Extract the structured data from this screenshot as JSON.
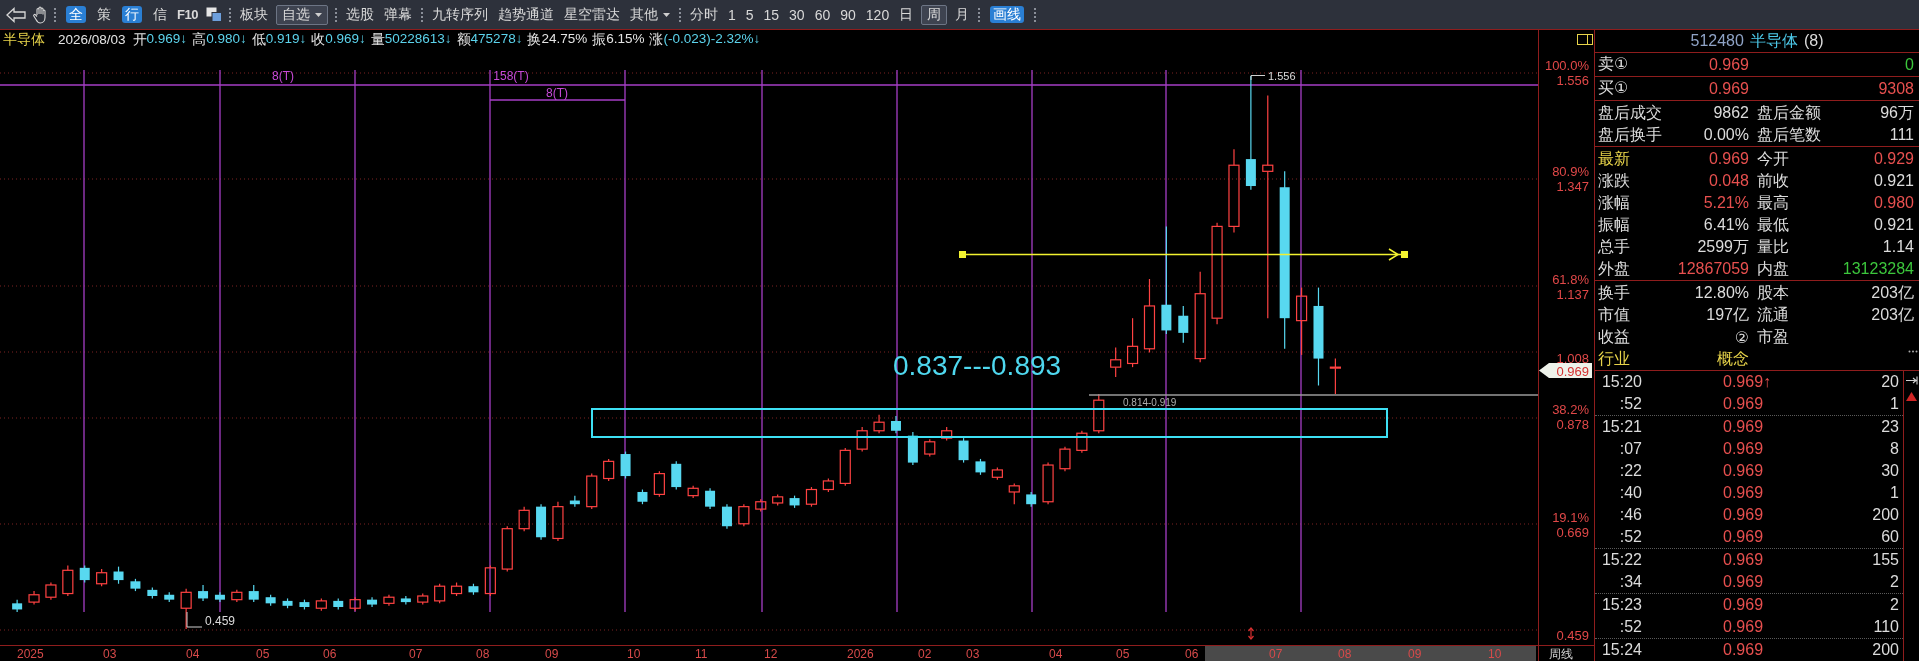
{
  "toolbar": {
    "groups": [
      {
        "items": [
          {
            "kind": "badge",
            "label": "全",
            "selected": false
          },
          {
            "kind": "text",
            "label": "策",
            "selected": false
          },
          {
            "kind": "badge",
            "label": "行",
            "selected": false
          },
          {
            "kind": "text",
            "label": "信",
            "selected": false
          },
          {
            "kind": "strong",
            "label": "F10",
            "selected": false
          }
        ]
      },
      {
        "items": [
          {
            "kind": "text",
            "label": "板块",
            "selected": false
          },
          {
            "kind": "dropdown",
            "label": "自选",
            "selected": true
          }
        ]
      },
      {
        "items": [
          {
            "kind": "text",
            "label": "选股",
            "selected": false
          },
          {
            "kind": "text",
            "label": "弹幕",
            "selected": false
          }
        ]
      },
      {
        "items": [
          {
            "kind": "text",
            "label": "九转序列",
            "selected": false
          },
          {
            "kind": "text",
            "label": "趋势通道",
            "selected": false
          },
          {
            "kind": "text",
            "label": "星空雷达",
            "selected": false
          },
          {
            "kind": "dropdown",
            "label": "其他",
            "selected": false
          }
        ]
      },
      {
        "items": [
          {
            "kind": "text",
            "label": "分时",
            "selected": false
          },
          {
            "kind": "text",
            "label": "1",
            "selected": false
          },
          {
            "kind": "text",
            "label": "5",
            "selected": false
          },
          {
            "kind": "text",
            "label": "15",
            "selected": false
          },
          {
            "kind": "text",
            "label": "30",
            "selected": false
          },
          {
            "kind": "text",
            "label": "60",
            "selected": false
          },
          {
            "kind": "text",
            "label": "90",
            "selected": false
          },
          {
            "kind": "text",
            "label": "120",
            "selected": false
          },
          {
            "kind": "text",
            "label": "日",
            "selected": false
          },
          {
            "kind": "text",
            "label": "周",
            "selected": true
          },
          {
            "kind": "text",
            "label": "月",
            "selected": false
          }
        ]
      },
      {
        "items": [
          {
            "kind": "badge",
            "label": "画线",
            "selected": false
          }
        ]
      }
    ]
  },
  "quote_bar": {
    "name": "半导体",
    "date": "2026/08/03",
    "fields": [
      {
        "label": "开",
        "value": "0.969↓",
        "color": "#5cd3ec"
      },
      {
        "label": "高",
        "value": "0.980↓",
        "color": "#5cd3ec"
      },
      {
        "label": "低",
        "value": "0.919↓",
        "color": "#5cd3ec"
      },
      {
        "label": "收",
        "value": "0.969↓",
        "color": "#5cd3ec"
      },
      {
        "label": "量",
        "value": "50228613↓",
        "color": "#5cd3ec"
      },
      {
        "label": "额",
        "value": "475278↓",
        "color": "#5cd3ec"
      },
      {
        "label": "换",
        "value": "24.75%",
        "color": "#e4e4e4"
      },
      {
        "label": "振",
        "value": "6.15%",
        "color": "#e4e4e4"
      },
      {
        "label": "涨",
        "value": "(-0.023)-2.32%↓",
        "color": "#5cd3ec"
      }
    ]
  },
  "chart": {
    "cycle_labels": [
      "8(T)",
      "158(T)",
      "8(T)"
    ],
    "high_label": "1.556",
    "low_label": "0.459",
    "zone_label": "0.837---0.893",
    "zone_note": "0.814-0.919",
    "price_axis": [
      {
        "percent": "100.0%",
        "price": "1.556"
      },
      {
        "percent": "80.9%",
        "price": "1.347"
      },
      {
        "percent": "61.8%",
        "price": "1.137"
      },
      {
        "price": "1.008"
      },
      {
        "percent": "38.2%",
        "price": "0.878"
      },
      {
        "percent": "19.1%",
        "price": "0.669"
      },
      {
        "price": "0.459"
      }
    ],
    "current_price": "0.969",
    "x_labels": [
      "2025",
      "03",
      "04",
      "05",
      "06",
      "07",
      "08",
      "09",
      "10",
      "11",
      "12",
      "2026",
      "02",
      "03",
      "04",
      "05",
      "06",
      "07",
      "08",
      "09",
      "10"
    ],
    "period_label": "周线"
  },
  "quote_panel": {
    "code": "512480",
    "name": "半导体",
    "count": "(8)",
    "order_book": [
      {
        "label": "卖①",
        "cells": [
          {
            "text": "0.969",
            "color": "#e8504f"
          },
          {
            "text": "0",
            "color": "#3cc63c"
          }
        ]
      },
      {
        "label": "买①",
        "cells": [
          {
            "text": "0.969",
            "color": "#e8504f"
          },
          {
            "text": "9308",
            "color": "#e8504f"
          }
        ]
      }
    ],
    "sections": [
      {
        "rows": [
          {
            "cells": [
              {
                "text": "盘后成交",
                "color": "#dcdcdc"
              },
              {
                "text": "9862",
                "color": "#dcdcdc"
              },
              {
                "text": "盘后金额",
                "color": "#dcdcdc"
              },
              {
                "text": "96万",
                "color": "#dcdcdc"
              }
            ]
          },
          {
            "cells": [
              {
                "text": "盘后换手",
                "color": "#dcdcdc"
              },
              {
                "text": "0.00%",
                "color": "#dcdcdc"
              },
              {
                "text": "盘后笔数",
                "color": "#dcdcdc"
              },
              {
                "text": "111",
                "color": "#dcdcdc"
              }
            ]
          }
        ]
      },
      {
        "rows": [
          {
            "cells": [
              {
                "text": "最新",
                "color": "#e8d44a"
              },
              {
                "text": "0.969",
                "color": "#e8504f"
              },
              {
                "text": "今开",
                "color": "#dcdcdc"
              },
              {
                "text": "0.929",
                "color": "#e8504f"
              }
            ]
          },
          {
            "cells": [
              {
                "text": "涨跌",
                "color": "#dcdcdc"
              },
              {
                "text": "0.048",
                "color": "#e8504f"
              },
              {
                "text": "前收",
                "color": "#dcdcdc"
              },
              {
                "text": "0.921",
                "color": "#dcdcdc"
              }
            ]
          },
          {
            "cells": [
              {
                "text": "涨幅",
                "color": "#dcdcdc"
              },
              {
                "text": "5.21%",
                "color": "#e8504f"
              },
              {
                "text": "最高",
                "color": "#dcdcdc"
              },
              {
                "text": "0.980",
                "color": "#e8504f"
              }
            ]
          },
          {
            "cells": [
              {
                "text": "振幅",
                "color": "#dcdcdc"
              },
              {
                "text": "6.41%",
                "color": "#dcdcdc"
              },
              {
                "text": "最低",
                "color": "#dcdcdc"
              },
              {
                "text": "0.921",
                "color": "#dcdcdc"
              }
            ]
          },
          {
            "cells": [
              {
                "text": "总手",
                "color": "#dcdcdc"
              },
              {
                "text": "2599万",
                "color": "#dcdcdc"
              },
              {
                "text": "量比",
                "color": "#dcdcdc"
              },
              {
                "text": "1.14",
                "color": "#dcdcdc"
              }
            ]
          },
          {
            "cells": [
              {
                "text": "外盘",
                "color": "#dcdcdc"
              },
              {
                "text": "12867059",
                "color": "#e8504f"
              },
              {
                "text": "内盘",
                "color": "#dcdcdc"
              },
              {
                "text": "13123284",
                "color": "#3cc63c"
              }
            ]
          }
        ]
      },
      {
        "rows": [
          {
            "cells": [
              {
                "text": "换手",
                "color": "#dcdcdc"
              },
              {
                "text": "12.80%",
                "color": "#dcdcdc"
              },
              {
                "text": "股本",
                "color": "#dcdcdc"
              },
              {
                "text": "203亿",
                "color": "#dcdcdc"
              }
            ]
          },
          {
            "cells": [
              {
                "text": "市值",
                "color": "#dcdcdc"
              },
              {
                "text": "197亿",
                "color": "#dcdcdc"
              },
              {
                "text": "流通",
                "color": "#dcdcdc"
              },
              {
                "text": "203亿",
                "color": "#dcdcdc"
              }
            ]
          },
          {
            "cells": [
              {
                "text": "收益",
                "color": "#dcdcdc"
              },
              {
                "text": "②",
                "color": "#dcdcdc"
              },
              {
                "text": "市盈",
                "color": "#dcdcdc"
              }
            ]
          },
          {
            "cells": [
              {
                "text": "行业",
                "color": "#e8d44a"
              },
              {
                "text": "概念",
                "color": "#e8d44a"
              }
            ]
          }
        ]
      }
    ],
    "ticks": {
      "groups": [
        {
          "rows": [
            {
              "time": "15:20",
              "price": "0.969↑",
              "volume": "20"
            },
            {
              "time": ":52",
              "price": "0.969",
              "volume": "1"
            }
          ]
        },
        {
          "rows": [
            {
              "time": "15:21",
              "price": "0.969",
              "volume": "23"
            },
            {
              "time": ":07",
              "price": "0.969",
              "volume": "8"
            },
            {
              "time": ":22",
              "price": "0.969",
              "volume": "30"
            },
            {
              "time": ":40",
              "price": "0.969",
              "volume": "1"
            },
            {
              "time": ":46",
              "price": "0.969",
              "volume": "200"
            },
            {
              "time": ":52",
              "price": "0.969",
              "volume": "60"
            }
          ]
        },
        {
          "rows": [
            {
              "time": "15:22",
              "price": "0.969",
              "volume": "155"
            },
            {
              "time": ":34",
              "price": "0.969",
              "volume": "2"
            }
          ]
        },
        {
          "rows": [
            {
              "time": "15:23",
              "price": "0.969",
              "volume": "2"
            },
            {
              "time": ":52",
              "price": "0.969",
              "volume": "110"
            }
          ]
        },
        {
          "rows": [
            {
              "time": "15:24",
              "price": "0.969",
              "volume": "200"
            }
          ]
        }
      ]
    }
  }
}
